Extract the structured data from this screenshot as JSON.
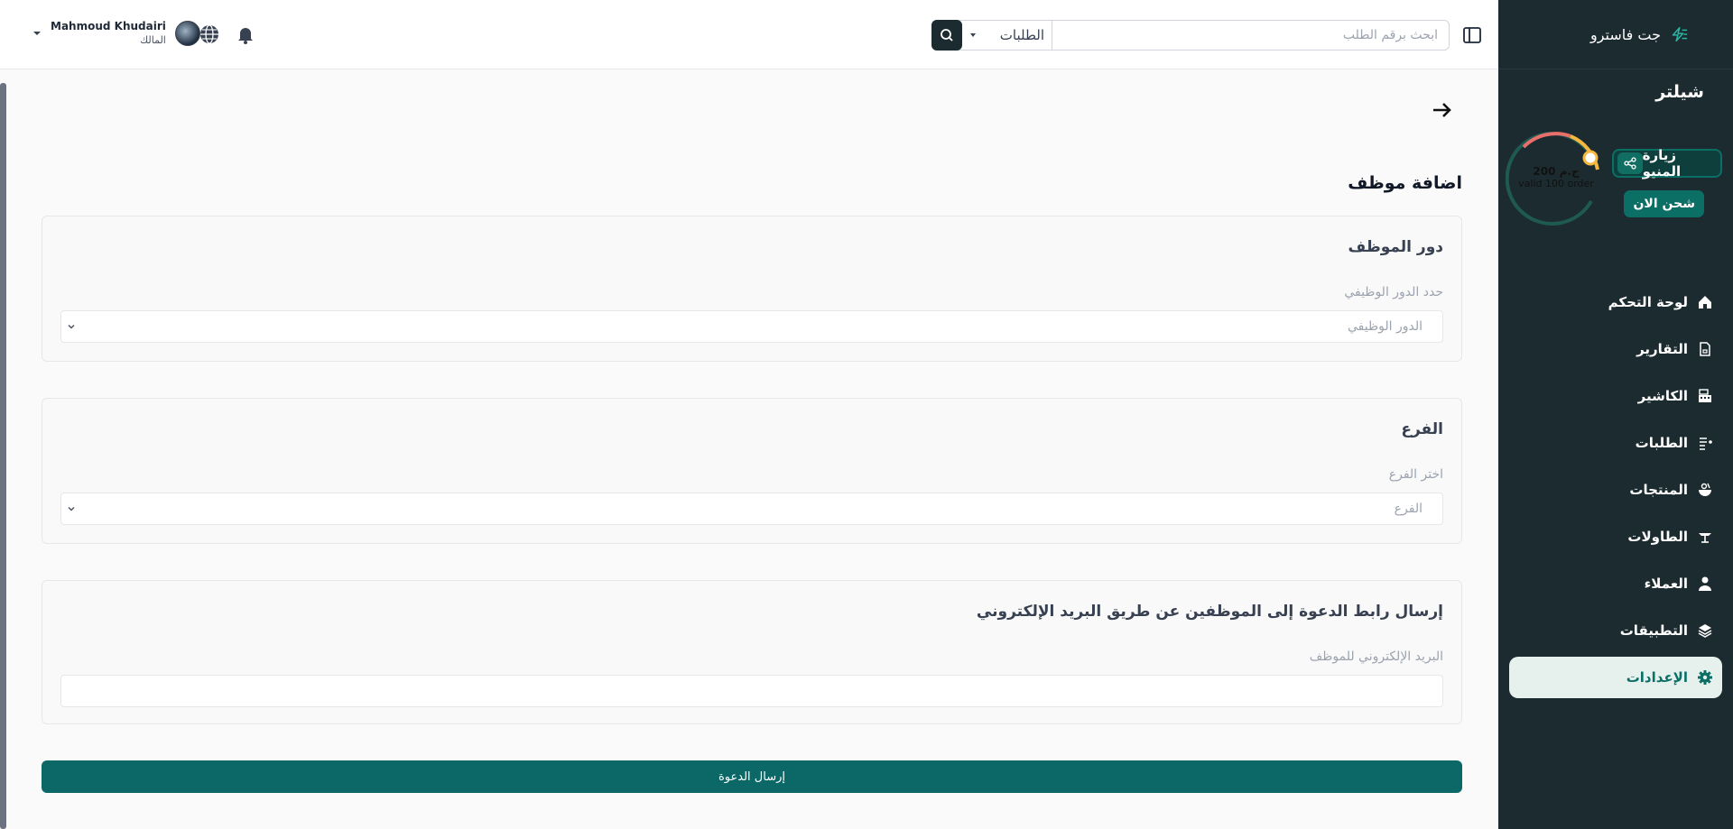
{
  "sidebar": {
    "brand": "جت فاسترو",
    "store_name": "شيلتر",
    "wallet": {
      "amount": "200 ج.م",
      "subtitle": "valid 100 order"
    },
    "visit_menu": "زيارة المنيو",
    "charge_now": "شحن الان",
    "items": [
      {
        "label": "لوحة التحكم",
        "icon": "home-icon"
      },
      {
        "label": "التقارير",
        "icon": "report-icon"
      },
      {
        "label": "الكاشير",
        "icon": "cashier-icon"
      },
      {
        "label": "الطلبات",
        "icon": "orders-icon"
      },
      {
        "label": "المنتجات",
        "icon": "products-icon"
      },
      {
        "label": "الطاولات",
        "icon": "tables-icon"
      },
      {
        "label": "العملاء",
        "icon": "customers-icon"
      },
      {
        "label": "التطبيقات",
        "icon": "apps-icon"
      },
      {
        "label": "الإعدادات",
        "icon": "settings-icon"
      }
    ]
  },
  "topbar": {
    "search_placeholder": "ابحث برقم الطلب",
    "search_scope": "الطلبات",
    "user_name": "Mahmoud Khudairi",
    "user_role": "المالك"
  },
  "main": {
    "title": "اضافة موظف",
    "role_card": {
      "title": "دور الموظف",
      "label": "حدد الدور الوظيفي",
      "placeholder": "الدور الوظيفي"
    },
    "branch_card": {
      "title": "الفرع",
      "label": "اختر الفرع",
      "placeholder": "الفرع"
    },
    "invite_card": {
      "title": "إرسال رابط الدعوة إلى الموظفين عن طريق البريد الإلكتروني",
      "label": "البريد الإلكتروني للموظف",
      "placeholder": ""
    },
    "submit": "إرسال الدعوة"
  },
  "colors": {
    "primary": "#0b6866",
    "sidebar_bg": "#1c2b30",
    "active_bg": "#e6f1ee"
  }
}
